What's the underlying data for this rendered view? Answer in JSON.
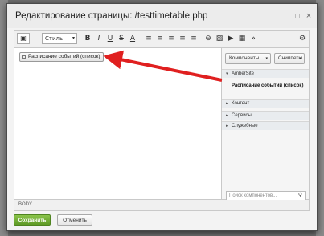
{
  "dialog": {
    "title": "Редактирование страницы: /testtimetable.php",
    "maximize_icon": "□",
    "close_icon": "×"
  },
  "toolbar": {
    "view_icon": "▣",
    "style_select": "Стиль",
    "style_caret": "▾",
    "bold": "B",
    "italic": "I",
    "underline": "U",
    "strike": "S",
    "font_color": "A",
    "ordered_list": "≡",
    "unordered_list": "≡",
    "indent": "≡",
    "outdent": "≡",
    "align": "≡",
    "link": "⊖",
    "image": "▨",
    "video": "▶",
    "table": "▦",
    "more": "»",
    "settings": "⚙"
  },
  "editor": {
    "component_chip": "Расписание событий (список)"
  },
  "sidebar": {
    "components_button": "Компоненты",
    "snippets_button": "Сниппеты",
    "caret": "▾",
    "sections": [
      {
        "label": "AmberSite",
        "arrow": "▾"
      },
      {
        "label": "Контент",
        "arrow": "▸"
      },
      {
        "label": "Сервисы",
        "arrow": "▸"
      },
      {
        "label": "Служебные",
        "arrow": "▸"
      }
    ],
    "entry": "Расписание событий (список)",
    "search_placeholder": "Поиск компонентов...",
    "search_icon": "🔍"
  },
  "statusbar": {
    "path": "BODY"
  },
  "footer": {
    "save": "Сохранить",
    "cancel": "Отменить"
  },
  "colors": {
    "arrow": "#e02020",
    "save_button": "#6aa72e"
  }
}
